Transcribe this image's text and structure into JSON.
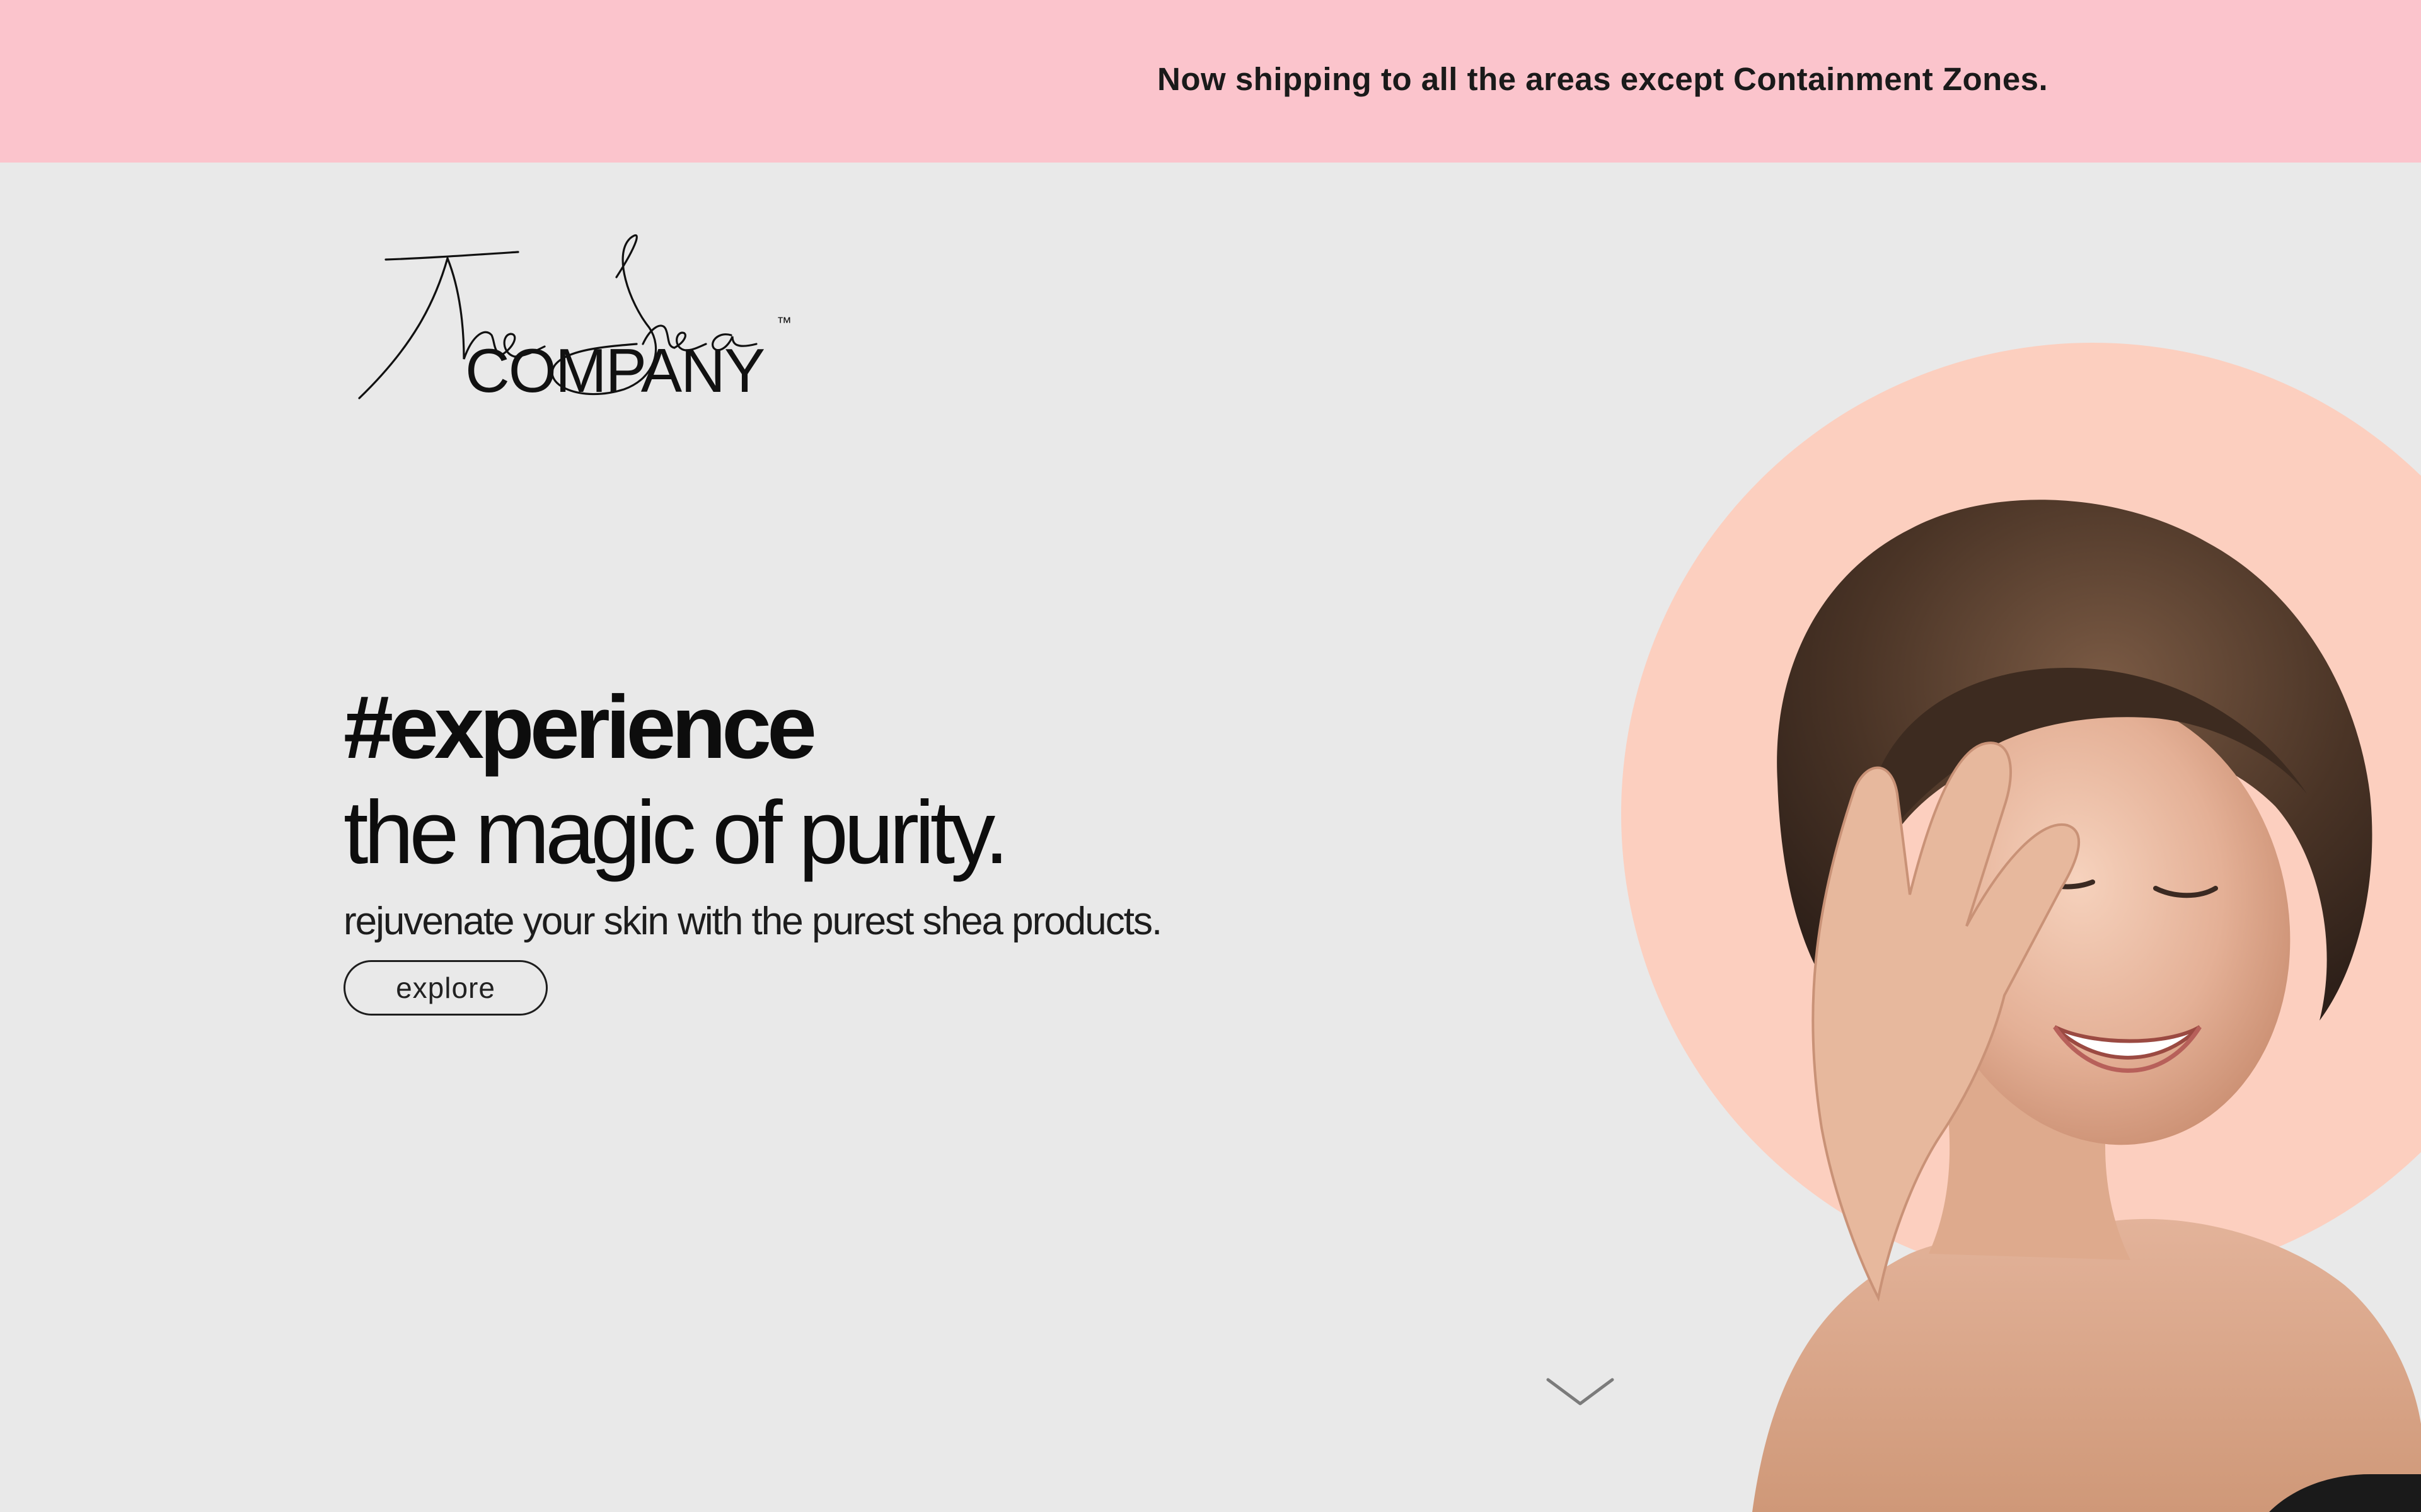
{
  "announcement": {
    "text": "Now shipping to all the areas except Containment Zones."
  },
  "logo": {
    "script_text": "The Shea",
    "wordmark": "COMPANY",
    "trademark": "™"
  },
  "hero": {
    "hashtag": "#experience",
    "heading": "the magic of purity.",
    "subheading": "rejuvenate your skin with the purest shea products.",
    "cta_label": "explore"
  },
  "colors": {
    "announcement_bg": "#fbc4cc",
    "page_bg": "#e9e9e9",
    "accent_circle": "#fccfbf",
    "text_dark": "#0d0d0d"
  },
  "icons": {
    "scroll": "chevron-down-icon"
  }
}
